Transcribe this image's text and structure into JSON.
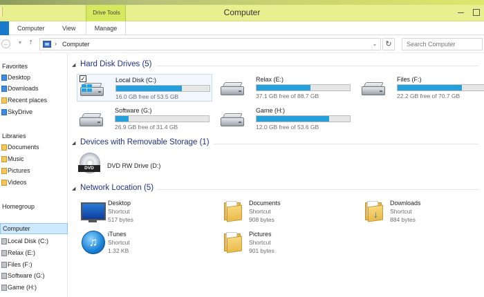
{
  "window": {
    "title": "Computer",
    "context_tab_group": "Drive Tools"
  },
  "ribbon": {
    "tabs": [
      {
        "label": "Computer"
      },
      {
        "label": "View"
      },
      {
        "label": "Manage"
      }
    ]
  },
  "address_bar": {
    "path": "Computer",
    "search_placeholder": "Search Computer"
  },
  "sidebar": {
    "favorites_header": "Favorites",
    "favorites": [
      {
        "label": "Desktop",
        "icon": "desktop-icon"
      },
      {
        "label": "Downloads",
        "icon": "downloads-icon"
      },
      {
        "label": "Recent places",
        "icon": "recent-places-icon"
      },
      {
        "label": "SkyDrive",
        "icon": "skydrive-icon"
      }
    ],
    "libraries_header": "Libraries",
    "libraries": [
      {
        "label": "Documents",
        "icon": "documents-icon"
      },
      {
        "label": "Music",
        "icon": "music-icon"
      },
      {
        "label": "Pictures",
        "icon": "pictures-icon"
      },
      {
        "label": "Videos",
        "icon": "videos-icon"
      }
    ],
    "homegroup": "Homegroup",
    "computer": "Computer",
    "drives": [
      {
        "label": "Local Disk (C:)"
      },
      {
        "label": "Relax (E:)"
      },
      {
        "label": "Files (F:)"
      },
      {
        "label": "Software (G:)"
      },
      {
        "label": "Game (H:)"
      }
    ]
  },
  "groups": {
    "hard_disks": "Hard Disk Drives (5)",
    "removable": "Devices with Removable Storage (1)",
    "network": "Network Location (5)"
  },
  "hard_disks": [
    {
      "name": "Local Disk (C:)",
      "free_text": "16.0 GB free of 53.5 GB",
      "used_fraction": 0.7,
      "selected": true,
      "checkbox": "✓"
    },
    {
      "name": "Relax (E:)",
      "free_text": "37.1 GB free of 88.7 GB",
      "used_fraction": 0.58,
      "selected": false
    },
    {
      "name": "Files (F:)",
      "free_text": "22.2 GB free of 70.7 GB",
      "used_fraction": 0.69,
      "selected": false
    },
    {
      "name": "Software (G:)",
      "free_text": "26.9 GB free of 31.4 GB",
      "used_fraction": 0.14,
      "selected": false
    },
    {
      "name": "Game (H:)",
      "free_text": "12.0 GB free of 53.6 GB",
      "used_fraction": 0.78,
      "selected": false
    }
  ],
  "removable": [
    {
      "name": "DVD RW Drive (D:)",
      "badge": "DVD"
    }
  ],
  "network_locations": [
    {
      "name": "Desktop",
      "type": "Shortcut",
      "size": "517 bytes",
      "icon": "monitor-icon"
    },
    {
      "name": "Documents",
      "type": "Shortcut",
      "size": "908 bytes",
      "icon": "folder-icon"
    },
    {
      "name": "Downloads",
      "type": "Shortcut",
      "size": "884 bytes",
      "icon": "downloads-folder-icon"
    },
    {
      "name": "iTunes",
      "type": "Shortcut",
      "size": "1.32 KB",
      "icon": "itunes-icon",
      "glyph": "♫"
    },
    {
      "name": "Pictures",
      "type": "Shortcut",
      "size": "901 bytes",
      "icon": "folder-icon"
    }
  ],
  "colors": {
    "title_bar": "#e8ef8e",
    "accent": "#26a0da",
    "group_heading": "#1e3287",
    "selection": "#cde8ff"
  }
}
